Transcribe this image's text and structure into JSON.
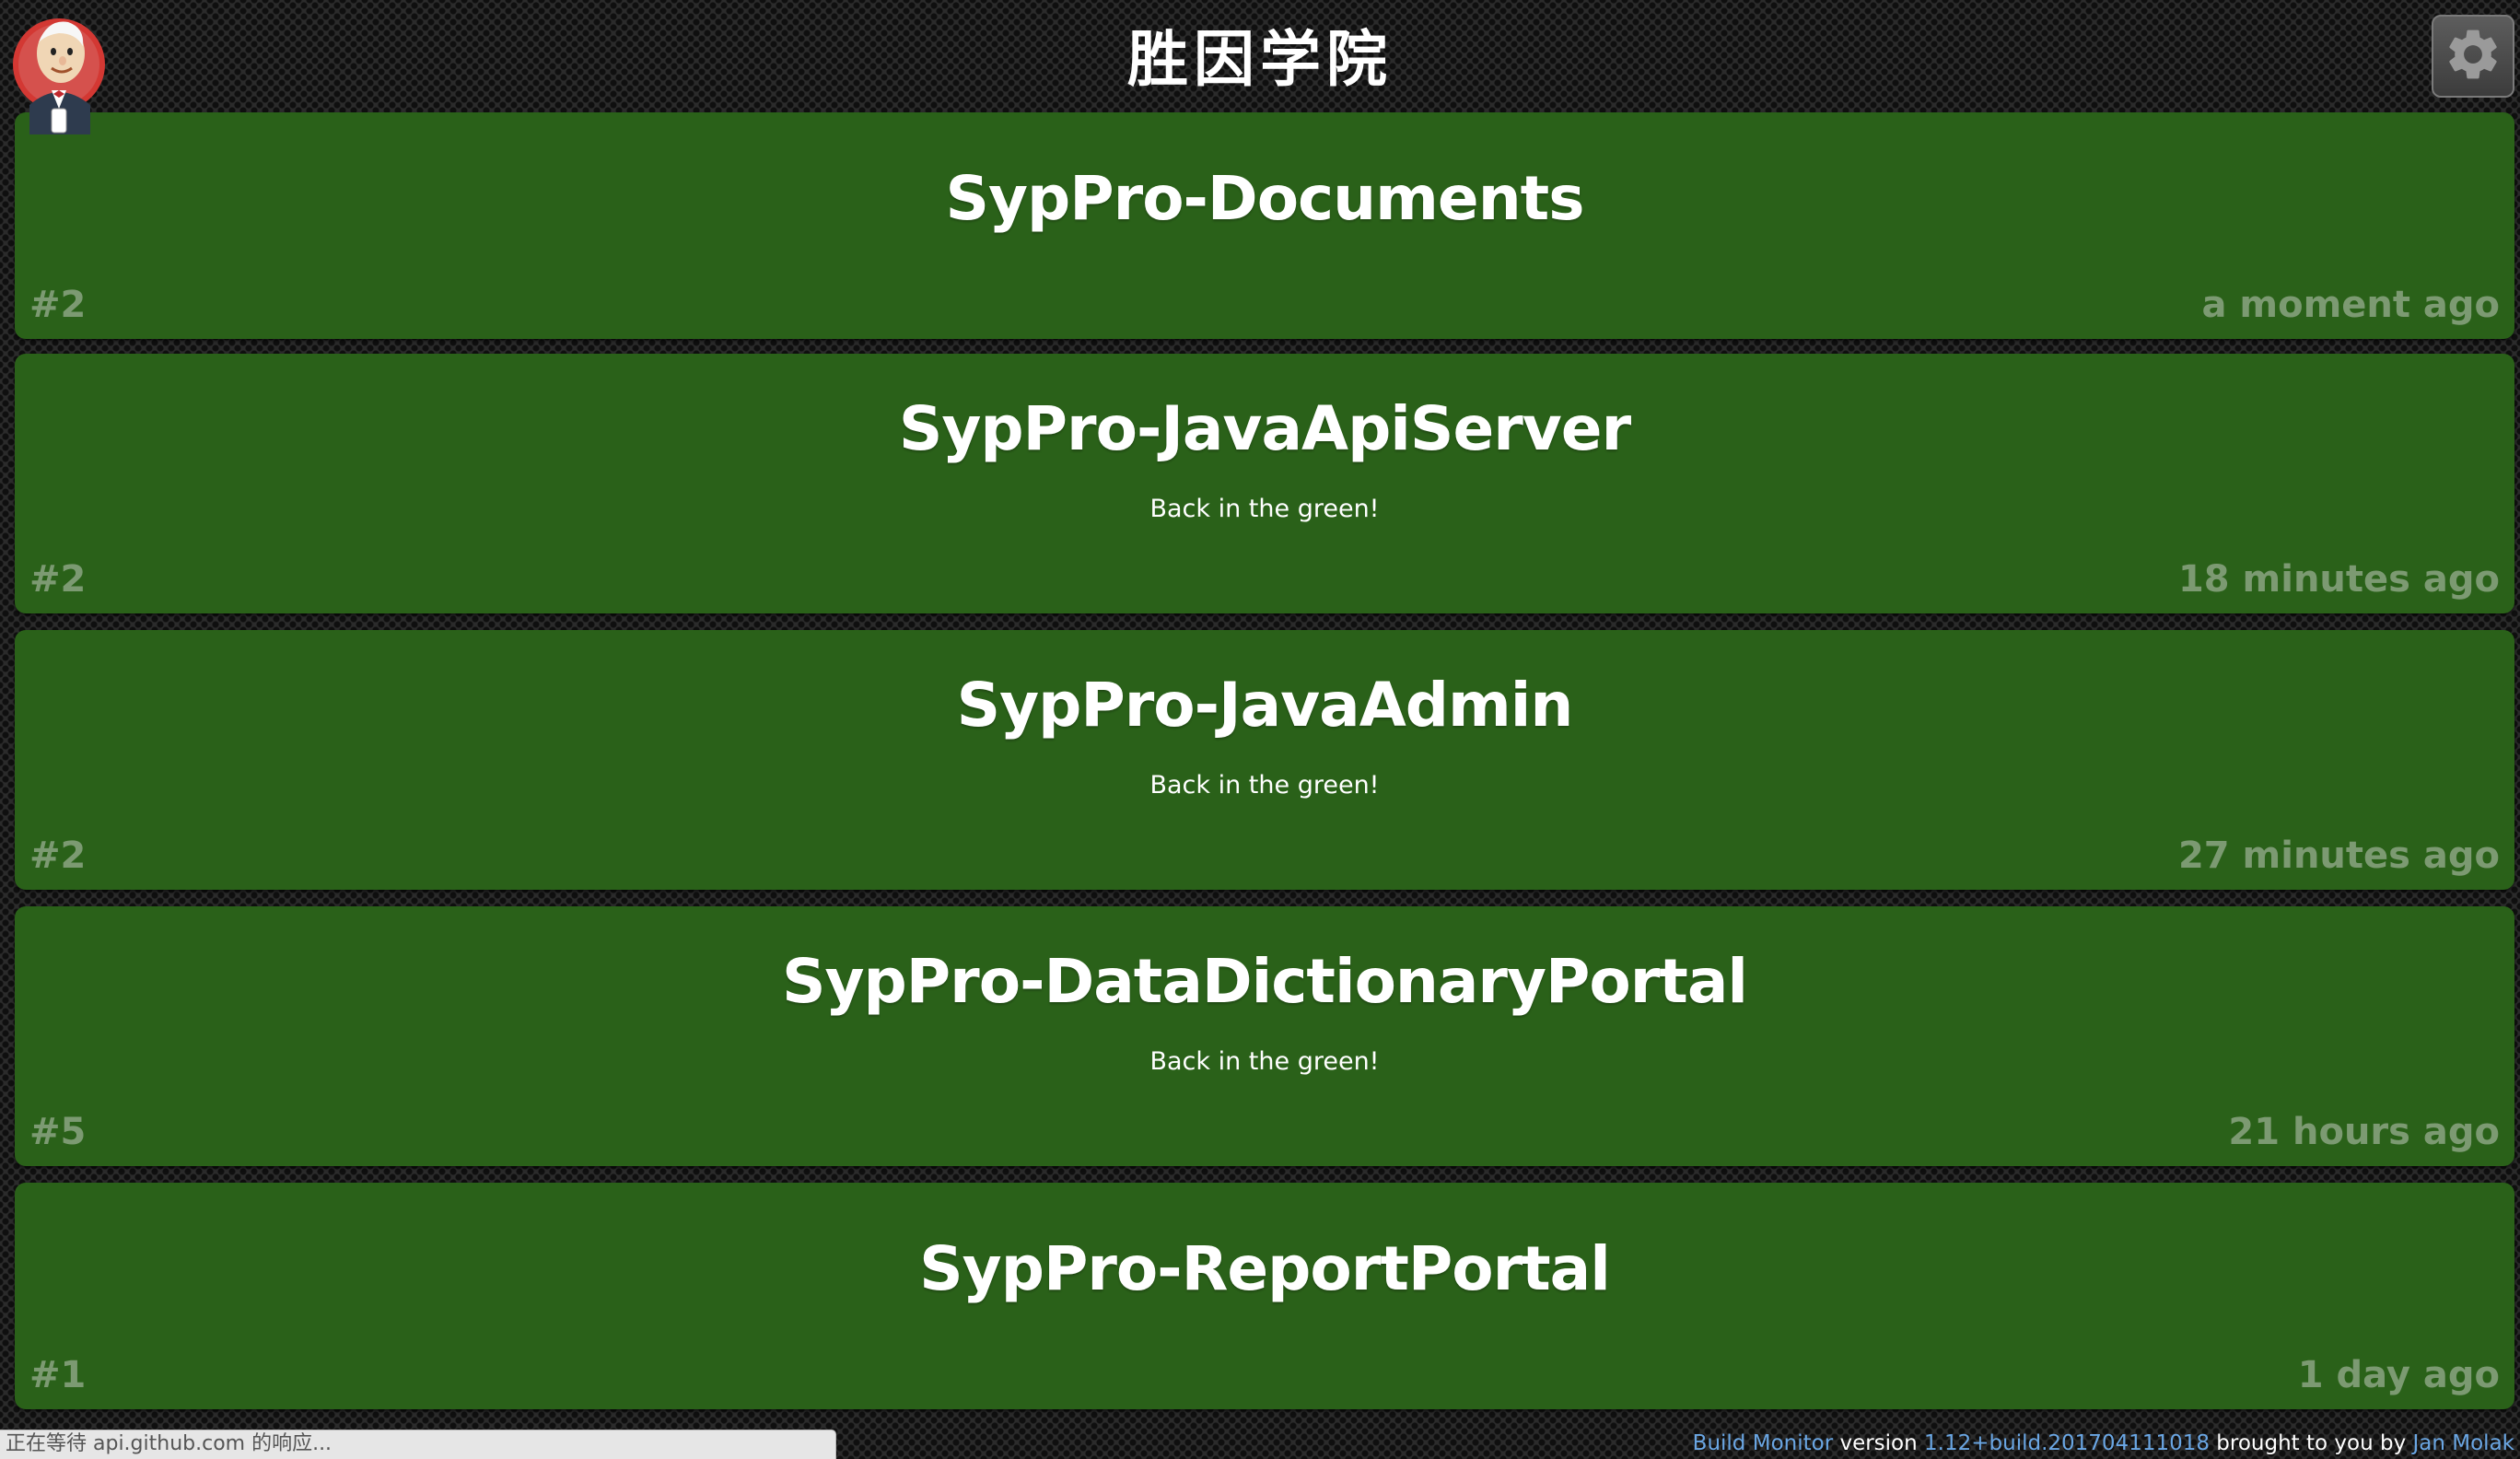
{
  "header": {
    "title": "胜因学院"
  },
  "jobs": [
    {
      "name": "SypPro-Documents",
      "status": "",
      "number": "#2",
      "time": "a moment ago"
    },
    {
      "name": "SypPro-JavaApiServer",
      "status": "Back in the green!",
      "number": "#2",
      "time": "18 minutes ago"
    },
    {
      "name": "SypPro-JavaAdmin",
      "status": "Back in the green!",
      "number": "#2",
      "time": "27 minutes ago"
    },
    {
      "name": "SypPro-DataDictionaryPortal",
      "status": "Back in the green!",
      "number": "#5",
      "time": "21 hours ago"
    },
    {
      "name": "SypPro-ReportPortal",
      "status": "",
      "number": "#1",
      "time": "1 day ago"
    }
  ],
  "browser_status": "正在等待 api.github.com 的响应...",
  "footer": {
    "product_link": "Build Monitor",
    "version_label": "version",
    "version_link": "1.12+build.201704111018",
    "brought_label": "brought to you by",
    "author_link": "Jan Molak"
  },
  "colors": {
    "job_success": "#2a6119",
    "job_meta": "#7c9a72",
    "link": "#6aa6e3"
  },
  "icons": {
    "logo": "jenkins-butler-logo",
    "settings": "gear-icon"
  }
}
